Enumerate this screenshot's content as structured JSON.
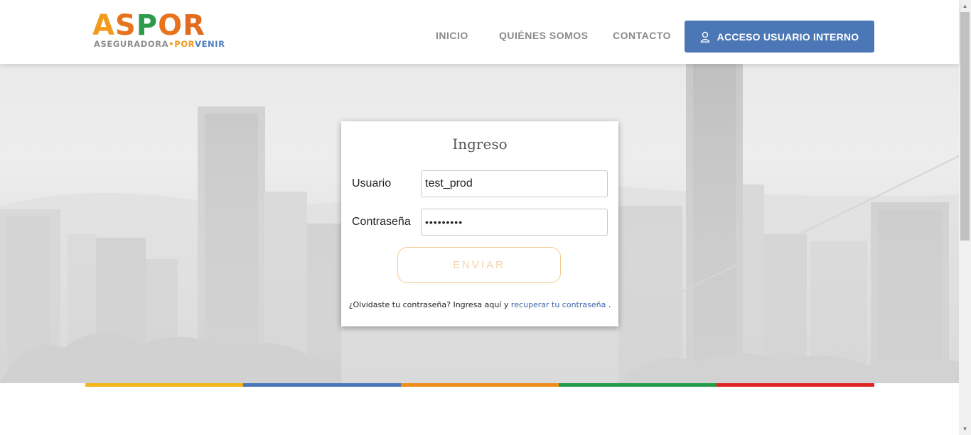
{
  "header": {
    "logo": {
      "letters": [
        "A",
        "S",
        "P",
        "O",
        "R"
      ],
      "sub_part1": "ASEGURADORA",
      "sub_dot": "•",
      "sub_part2": "POR",
      "sub_part3": "VENIR"
    },
    "nav": {
      "inicio": "INICIO",
      "quienes": "QUIÉNES SOMOS",
      "contacto": "CONTACTO"
    },
    "access_button": {
      "label": "ACCESO USUARIO INTERNO",
      "icon": "user-icon",
      "color": "#4b77b6"
    }
  },
  "login": {
    "title": "Ingreso",
    "user_label": "Usuario",
    "user_value": "test_prod",
    "pass_label": "Contraseña",
    "pass_value": "•••••••••",
    "submit_label": "ENVIAR",
    "forgot_text": "¿Olvidaste tu contraseña? Ingresa aquí y",
    "forgot_link": "recuperar tu contraseña",
    "forgot_end": "."
  },
  "stripe_colors": [
    "#f2b51a",
    "#4b77b6",
    "#ef8d1c",
    "#229a49",
    "#e02424"
  ]
}
